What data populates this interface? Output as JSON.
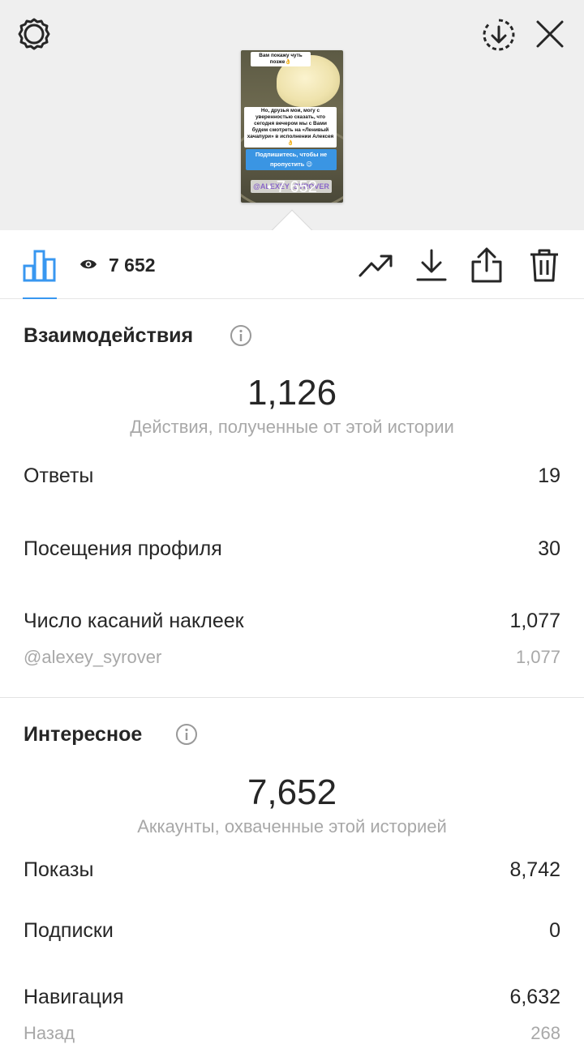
{
  "story": {
    "sticker_1": "Вам покажу чуть позже👌",
    "sticker_2": "Но, друзья мои, могу с уверенностью сказать, что сегодня вечером мы с Вами будем смотреть на «Ленивый хачапури» в исполнении Алексея👌",
    "sticker_3": "Подпишитесь, чтобы не пропустить 😉",
    "mention": "@ALEXEY_SYROVER",
    "views_overlay": "7 652"
  },
  "toolbar": {
    "views": "7 652",
    "icons": [
      "settings-gear-icon",
      "download-circle-icon",
      "close-icon",
      "bar-chart-icon",
      "eye-icon",
      "trending-icon",
      "download-icon",
      "share-icon",
      "trash-icon"
    ]
  },
  "interactions": {
    "title": "Взаимодействия",
    "total": "1,126",
    "subtitle": "Действия, полученные от этой истории",
    "rows": [
      {
        "label": "Ответы",
        "value": "19"
      },
      {
        "label": "Посещения профиля",
        "value": "30"
      },
      {
        "label": "Число касаний наклеек",
        "value": "1,077"
      },
      {
        "label": "@alexey_syrover",
        "value": "1,077"
      }
    ]
  },
  "discovery": {
    "title": "Интересное",
    "total": "7,652",
    "subtitle": "Аккаунты, охваченные этой историей",
    "rows": [
      {
        "label": "Показы",
        "value": "8,742"
      },
      {
        "label": "Подписки",
        "value": "0"
      },
      {
        "label": "Навигация",
        "value": "6,632"
      },
      {
        "label": "Назад",
        "value": "268"
      }
    ]
  },
  "colors": {
    "accent": "#3897f0",
    "top_background": "#efefef",
    "text": "#262626",
    "muted": "#a8a8a8"
  }
}
